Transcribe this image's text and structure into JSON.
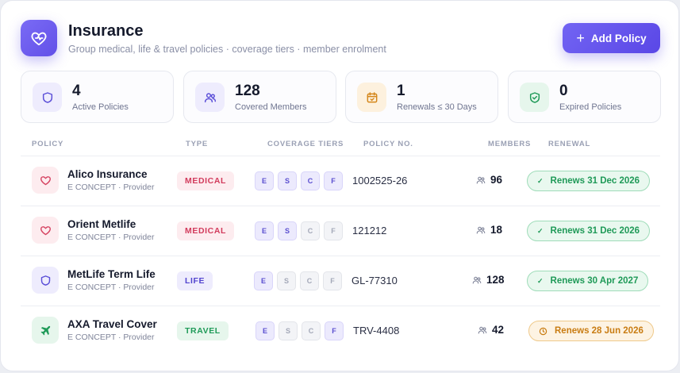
{
  "header": {
    "icon": "heart-shield-icon",
    "title": "Insurance",
    "subtitle": "Group medical, life & travel policies · coverage tiers · member enrolment",
    "add_label": "Add Policy",
    "accent": "#6250e8"
  },
  "stats": [
    {
      "icon": "shield-icon",
      "value": "4",
      "label": "Active Policies",
      "color": "#5b4fd8",
      "bg": "#eeecfd"
    },
    {
      "icon": "users-icon",
      "value": "128",
      "label": "Covered Members",
      "color": "#5b4fd8",
      "bg": "#eeecfd"
    },
    {
      "icon": "calendar-icon",
      "value": "1",
      "label": "Renewals ≤ 30 Days",
      "color": "#d4861a",
      "bg": "#fdf1de"
    },
    {
      "icon": "shield-check-icon",
      "value": "0",
      "label": "Expired Policies",
      "color": "#1f9a58",
      "bg": "#e6f6ec"
    }
  ],
  "table": {
    "headers": {
      "policy": "POLICY",
      "type": "TYPE",
      "tiers": "COVERAGE TIERS",
      "policy_no": "POLICY NO.",
      "members": "MEMBERS",
      "renewal": "RENEWAL"
    },
    "rows": [
      {
        "icon": "heart-icon",
        "name": "Alico Insurance",
        "provider": "E CONCEPT · Provider",
        "type": "MEDICAL",
        "tiers": [
          {
            "l": "E",
            "on": true
          },
          {
            "l": "S",
            "on": true
          },
          {
            "l": "C",
            "on": true
          },
          {
            "l": "F",
            "on": true
          }
        ],
        "policy_no": "1002525-26",
        "members": "96",
        "renewal": "Renews 31 Dec 2026",
        "status": "ok"
      },
      {
        "icon": "heart-icon",
        "name": "Orient Metlife",
        "provider": "E CONCEPT · Provider",
        "type": "MEDICAL",
        "tiers": [
          {
            "l": "E",
            "on": true
          },
          {
            "l": "S",
            "on": true
          },
          {
            "l": "C",
            "on": false
          },
          {
            "l": "F",
            "on": false
          }
        ],
        "policy_no": "121212",
        "members": "18",
        "renewal": "Renews 31 Dec 2026",
        "status": "ok"
      },
      {
        "icon": "shield-icon",
        "name": "MetLife Term Life",
        "provider": "E CONCEPT · Provider",
        "type": "LIFE",
        "tiers": [
          {
            "l": "E",
            "on": true
          },
          {
            "l": "S",
            "on": false
          },
          {
            "l": "C",
            "on": false
          },
          {
            "l": "F",
            "on": false
          }
        ],
        "policy_no": "GL-77310",
        "members": "128",
        "renewal": "Renews 30 Apr 2027",
        "status": "ok"
      },
      {
        "icon": "plane-icon",
        "name": "AXA Travel Cover",
        "provider": "E CONCEPT · Provider",
        "type": "TRAVEL",
        "tiers": [
          {
            "l": "E",
            "on": true
          },
          {
            "l": "S",
            "on": false
          },
          {
            "l": "C",
            "on": false
          },
          {
            "l": "F",
            "on": true
          }
        ],
        "policy_no": "TRV-4408",
        "members": "42",
        "renewal": "Renews 28 Jun 2026",
        "status": "warn"
      }
    ]
  }
}
